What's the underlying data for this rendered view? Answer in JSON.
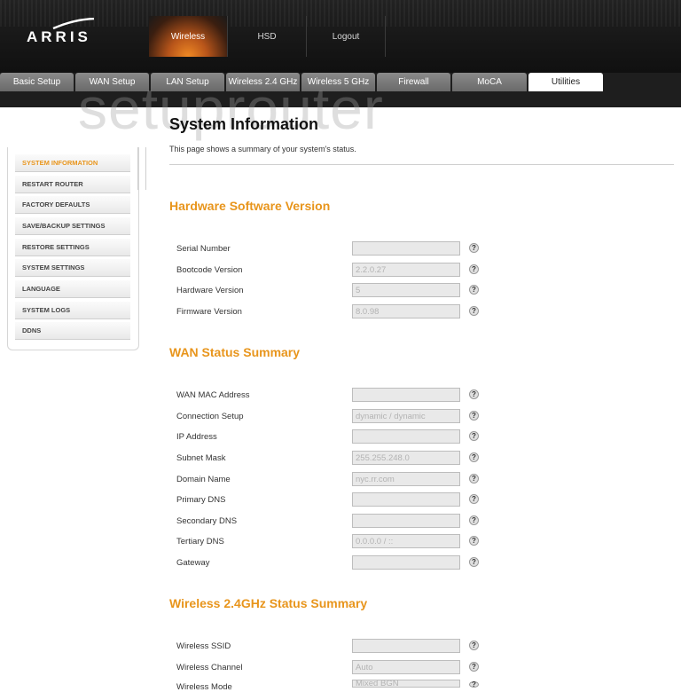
{
  "header": {
    "logo_text": "ARRIS",
    "main_nav": [
      {
        "label": "Wireless",
        "active": true
      },
      {
        "label": "HSD",
        "active": false
      },
      {
        "label": "Logout",
        "active": false
      }
    ],
    "sub_tabs": [
      {
        "label": "Basic Setup",
        "active": false
      },
      {
        "label": "WAN Setup",
        "active": false
      },
      {
        "label": "LAN Setup",
        "active": false
      },
      {
        "label": "Wireless 2.4 GHz",
        "active": false
      },
      {
        "label": "Wireless 5 GHz",
        "active": false
      },
      {
        "label": "Firewall",
        "active": false
      },
      {
        "label": "MoCA",
        "active": false
      },
      {
        "label": "Utilities",
        "active": true
      }
    ],
    "accent_color": "#e8951c"
  },
  "watermark": "setuprouter",
  "sidebar": {
    "items": [
      {
        "label": "SYSTEM INFORMATION",
        "active": true
      },
      {
        "label": "RESTART ROUTER",
        "active": false
      },
      {
        "label": "FACTORY DEFAULTS",
        "active": false
      },
      {
        "label": "SAVE/BACKUP SETTINGS",
        "active": false
      },
      {
        "label": "RESTORE SETTINGS",
        "active": false
      },
      {
        "label": "SYSTEM SETTINGS",
        "active": false
      },
      {
        "label": "LANGUAGE",
        "active": false
      },
      {
        "label": "SYSTEM LOGS",
        "active": false
      },
      {
        "label": "DDNS",
        "active": false
      }
    ]
  },
  "main": {
    "title": "System Information",
    "description": "This page shows a summary of your system's status.",
    "help_glyph": "?",
    "sections": [
      {
        "title": "Hardware Software Version",
        "rows": [
          {
            "label": "Serial Number",
            "value": ""
          },
          {
            "label": "Bootcode Version",
            "value": "2.2.0.27"
          },
          {
            "label": "Hardware Version",
            "value": "5"
          },
          {
            "label": "Firmware Version",
            "value": "8.0.98"
          }
        ]
      },
      {
        "title": "WAN Status Summary",
        "rows": [
          {
            "label": "WAN MAC Address",
            "value": ""
          },
          {
            "label": "Connection Setup",
            "value": "dynamic / dynamic"
          },
          {
            "label": "IP Address",
            "value": ""
          },
          {
            "label": "Subnet Mask",
            "value": "255.255.248.0"
          },
          {
            "label": "Domain Name",
            "value": "nyc.rr.com"
          },
          {
            "label": "Primary DNS",
            "value": ""
          },
          {
            "label": "Secondary DNS",
            "value": ""
          },
          {
            "label": "Tertiary DNS",
            "value": "0.0.0.0 / ::"
          },
          {
            "label": "Gateway",
            "value": ""
          }
        ]
      },
      {
        "title": "Wireless 2.4GHz Status Summary",
        "rows": [
          {
            "label": "Wireless SSID",
            "value": ""
          },
          {
            "label": "Wireless Channel",
            "value": "Auto"
          },
          {
            "label": "Wireless Mode",
            "value": "Mixed BGN"
          }
        ]
      }
    ]
  }
}
